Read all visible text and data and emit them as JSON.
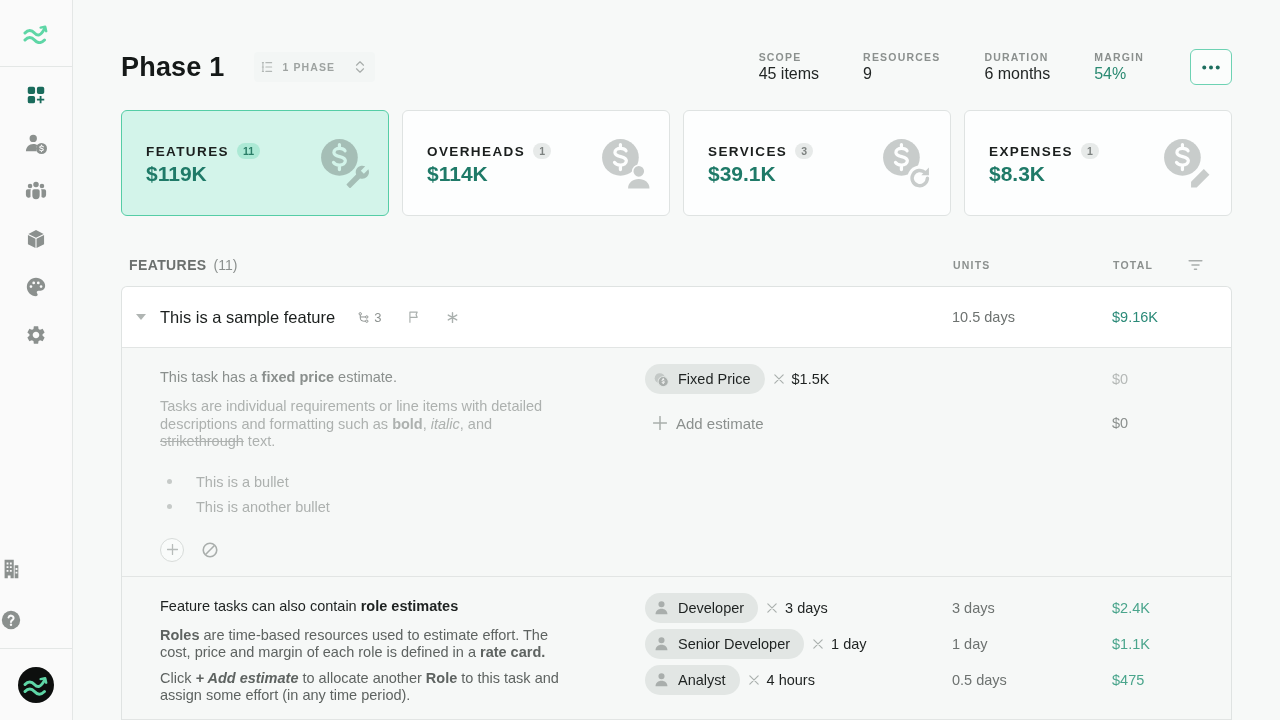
{
  "sidebar": {
    "nav_items": [
      {
        "selected": true
      },
      {
        "selected": false
      },
      {
        "selected": false
      },
      {
        "selected": false
      },
      {
        "selected": false
      },
      {
        "selected": false
      }
    ]
  },
  "header": {
    "title": "Phase 1",
    "phase_selector": "1 PHASE",
    "stats": [
      {
        "label": "SCOPE",
        "value": "45 items",
        "kind": "plain"
      },
      {
        "label": "RESOURCES",
        "value": "9",
        "kind": "plain"
      },
      {
        "label": "DURATION",
        "value": "6 months",
        "kind": "plain"
      },
      {
        "label": "MARGIN",
        "value": "54%",
        "kind": "accent"
      }
    ]
  },
  "summary_cards": [
    {
      "title": "FEATURES",
      "count": "11",
      "value": "$119K",
      "selected": true
    },
    {
      "title": "OVERHEADS",
      "count": "1",
      "value": "$114K",
      "selected": false
    },
    {
      "title": "SERVICES",
      "count": "3",
      "value": "$39.1K",
      "selected": false
    },
    {
      "title": "EXPENSES",
      "count": "1",
      "value": "$8.3K",
      "selected": false
    }
  ],
  "features": {
    "title": "FEATURES",
    "count": "(11)",
    "columns": [
      "UNITS",
      "TOTAL"
    ],
    "items": [
      {
        "title": "This is a sample feature",
        "expanded": true,
        "link_count": "3",
        "units": "10.5 days",
        "total": "$9.16K",
        "tasks": [
          {
            "disabled": true,
            "heading": "This task has a **fixed price** estimate.",
            "paragraphs": [
              [
                {
                  "text": "Tasks are individual requirements or line items with detailed descriptions and formatting such as **bold**, *italic*, and ",
                  "strikethrough": false,
                  "italic": false
                },
                {
                  "text": "strikethrough",
                  "strikethrough": true,
                  "italic": false
                },
                {
                  "text": " text.",
                  "strikethrough": false,
                  "italic": false
                }
              ]
            ],
            "bullets": [
              "This is a bullet",
              "This is another bullet"
            ],
            "actions": [
              {
                "kind": "add"
              },
              {
                "kind": "exclude"
              }
            ],
            "estimates": [
              {
                "kind": "fixed",
                "label": "Fixed Price",
                "quantity": "$1.5K",
                "total": "$0"
              }
            ],
            "add_estimate": {
              "label": "Add estimate",
              "total": "$0"
            }
          },
          {
            "disabled": false,
            "heading": "Feature tasks can also contain **role estimates**",
            "paragraphs": [
              [
                {
                  "text": "**Roles** are time-based resources used to estimate effort. The cost, price and margin of each role is defined in a **rate card.**",
                  "strikethrough": false,
                  "italic": false
                }
              ],
              [
                {
                  "text": "Click ",
                  "strikethrough": false,
                  "italic": false
                },
                {
                  "text": "**+ Add estimate**",
                  "strikethrough": false,
                  "italic": true
                },
                {
                  "text": " to allocate another **Role** to this task and assign some effort (in any time period).",
                  "strikethrough": false,
                  "italic": false
                }
              ]
            ],
            "estimates": [
              {
                "kind": "role",
                "label": "Developer",
                "quantity": "3 days",
                "units": "3 days",
                "total": "$2.4K"
              },
              {
                "kind": "role",
                "label": "Senior Developer",
                "quantity": "1 day",
                "units": "1 day",
                "total": "$1.1K"
              },
              {
                "kind": "role",
                "label": "Analyst",
                "quantity": "4 hours",
                "units": "0.5 days",
                "total": "$475"
              }
            ]
          }
        ]
      }
    ]
  }
}
